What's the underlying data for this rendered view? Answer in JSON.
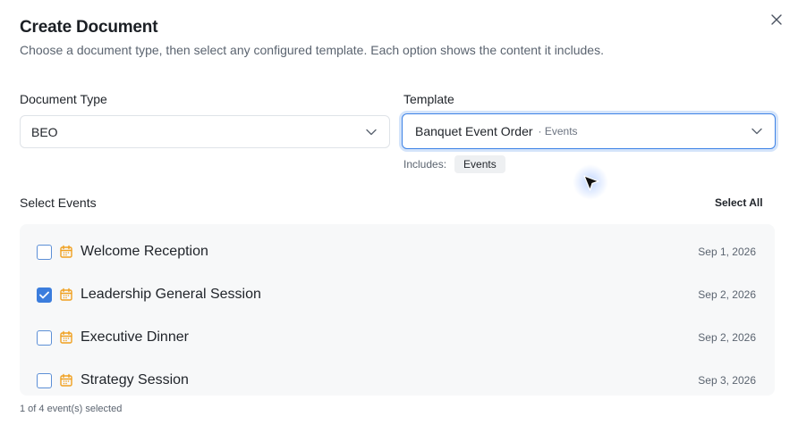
{
  "dialog": {
    "title": "Create Document",
    "subtitle": "Choose a document type, then select any configured template. Each option shows the content it includes."
  },
  "document_type": {
    "label": "Document Type",
    "value": "BEO"
  },
  "template": {
    "label": "Template",
    "value": "Banquet Event Order",
    "category": "· Events",
    "includes_label": "Includes:",
    "includes": [
      "Events"
    ]
  },
  "events_section": {
    "label": "Select Events",
    "select_all_label": "Select All",
    "items": [
      {
        "name": "Welcome Reception",
        "date": "Sep 1, 2026",
        "checked": false
      },
      {
        "name": "Leadership General Session",
        "date": "Sep 2, 2026",
        "checked": true
      },
      {
        "name": "Executive Dinner",
        "date": "Sep 2, 2026",
        "checked": false
      },
      {
        "name": "Strategy Session",
        "date": "Sep 3, 2026",
        "checked": false
      }
    ],
    "selection_summary": "1 of 4 event(s) selected"
  },
  "icons": {
    "close": "close-icon",
    "chevron": "chevron-down-icon",
    "calendar": "calendar-icon",
    "check": "check-icon",
    "cursor": "mouse-pointer-icon"
  },
  "colors": {
    "accent": "#3b7ddd",
    "calendar_icon": "#f0a020",
    "list_background": "#f7f8f9"
  }
}
